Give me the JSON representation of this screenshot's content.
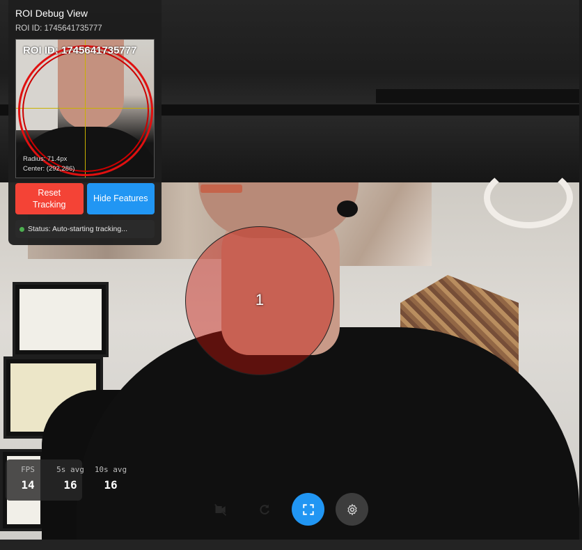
{
  "debug_panel": {
    "title": "ROI Debug View",
    "roi_id_label": "ROI ID: 1745641735777",
    "preview": {
      "overlay_title": "ROI ID: 1745641735777",
      "radius": "Radius: 71.4px",
      "center": "Center: (292,286)"
    },
    "reset_button": "Reset Tracking",
    "features_button": "Hide Features",
    "status": "Status: Auto-starting tracking..."
  },
  "roi_overlay": {
    "number": "1",
    "color": "#c8140a"
  },
  "fps": {
    "current": {
      "label": "FPS",
      "value": "14"
    },
    "avg5": {
      "label": "5s avg",
      "value": "16"
    },
    "avg10": {
      "label": "10s avg",
      "value": "16"
    }
  },
  "controls": {
    "items": [
      {
        "icon": "camera-off-icon",
        "state": "disabled"
      },
      {
        "icon": "refresh-icon",
        "state": "disabled"
      },
      {
        "icon": "fullscreen-icon",
        "state": "active"
      },
      {
        "icon": "settings-icon",
        "state": "normal"
      }
    ]
  },
  "colors": {
    "primary_blue": "#2196f3",
    "danger_red": "#f44336",
    "status_green": "#4caf50"
  }
}
